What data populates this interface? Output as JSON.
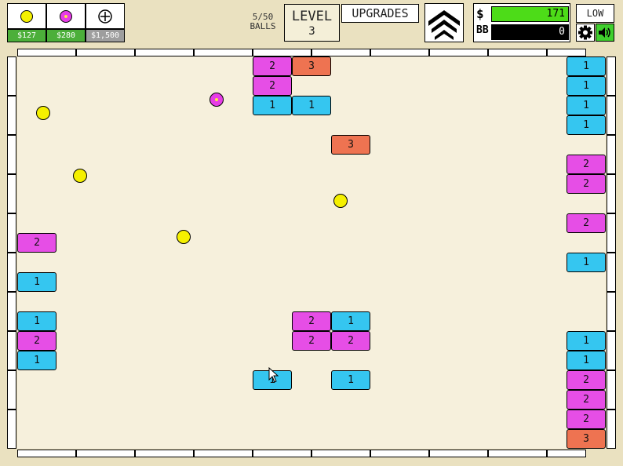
{
  "shop": [
    {
      "name": "basic-ball",
      "price": "$127",
      "affordable": true
    },
    {
      "name": "plasma-ball",
      "price": "$280",
      "affordable": true
    },
    {
      "name": "add-ball",
      "price": "$1,500",
      "affordable": false
    }
  ],
  "balls_count": {
    "value": "5/50",
    "label": "BALLS"
  },
  "level": {
    "label": "LEVEL",
    "value": "3"
  },
  "upgrades_label": "UPGRADES",
  "bank": {
    "cash_symbol": "$",
    "cash_value": "171",
    "bb_label": "BB",
    "bb_value": "0"
  },
  "quality_label": "LOW",
  "colors": {
    "hp1": "#35c6f0",
    "hp2": "#e64ee6",
    "hp3": "#ee7351",
    "ball": "#f5f000",
    "cash": "#4ddc18"
  },
  "bricks": [
    {
      "hp": "2",
      "row": 0,
      "col": 6
    },
    {
      "hp": "3",
      "row": 0,
      "col": 7
    },
    {
      "hp": "2",
      "row": 1,
      "col": 6
    },
    {
      "hp": "1",
      "row": 2,
      "col": 6
    },
    {
      "hp": "1",
      "row": 2,
      "col": 7
    },
    {
      "hp": "3",
      "row": 4,
      "col": 8
    },
    {
      "hp": "2",
      "row": 9,
      "col": 0
    },
    {
      "hp": "1",
      "row": 11,
      "col": 0
    },
    {
      "hp": "1",
      "row": 13,
      "col": 0
    },
    {
      "hp": "2",
      "row": 14,
      "col": 0
    },
    {
      "hp": "1",
      "row": 15,
      "col": 0
    },
    {
      "hp": "2",
      "row": 13,
      "col": 7
    },
    {
      "hp": "1",
      "row": 13,
      "col": 8
    },
    {
      "hp": "2",
      "row": 14,
      "col": 7
    },
    {
      "hp": "2",
      "row": 14,
      "col": 8
    },
    {
      "hp": "1",
      "row": 16,
      "col": 6
    },
    {
      "hp": "1",
      "row": 16,
      "col": 8
    },
    {
      "hp": "1",
      "row": 0,
      "col": 14
    },
    {
      "hp": "1",
      "row": 1,
      "col": 14
    },
    {
      "hp": "1",
      "row": 2,
      "col": 14
    },
    {
      "hp": "1",
      "row": 3,
      "col": 14
    },
    {
      "hp": "2",
      "row": 5,
      "col": 14
    },
    {
      "hp": "2",
      "row": 6,
      "col": 14
    },
    {
      "hp": "2",
      "row": 8,
      "col": 14
    },
    {
      "hp": "1",
      "row": 10,
      "col": 14
    },
    {
      "hp": "1",
      "row": 14,
      "col": 14
    },
    {
      "hp": "1",
      "row": 15,
      "col": 14
    },
    {
      "hp": "2",
      "row": 16,
      "col": 14
    },
    {
      "hp": "2",
      "row": 17,
      "col": 14
    },
    {
      "hp": "2",
      "row": 18,
      "col": 14
    },
    {
      "hp": "3",
      "row": 19,
      "col": 14
    }
  ]
}
